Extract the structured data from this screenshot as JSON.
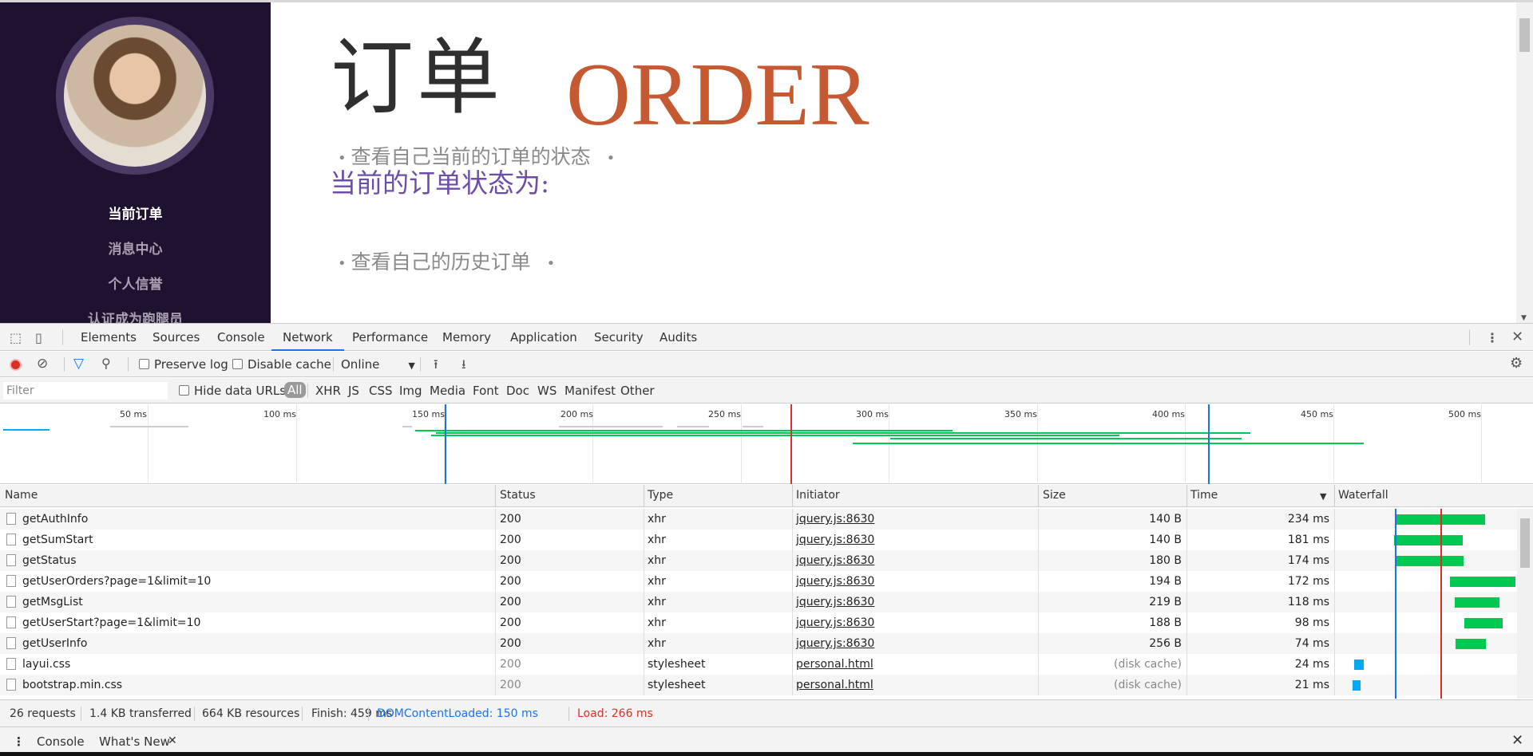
{
  "page": {
    "sidebar": {
      "links": [
        "当前订单",
        "消息中心",
        "个人信誉",
        "认证成为跑腿员"
      ]
    },
    "title_cn": "订单",
    "title_en": "ORDER",
    "bullet1": "查看自己当前的订单的状态",
    "status_title": "当前的订单状态为:",
    "bullet2": "查看自己的历史订单",
    "bullet_dot": "•"
  },
  "devtools": {
    "tabs": [
      "Elements",
      "Sources",
      "Console",
      "Network",
      "Performance",
      "Memory",
      "Application",
      "Security",
      "Audits"
    ],
    "active_tab": "Network",
    "toolbar": {
      "preserve_log": "Preserve log",
      "disable_cache": "Disable cache",
      "throttle": "Online"
    },
    "filter": {
      "placeholder": "Filter",
      "hide_data_urls": "Hide data URLs",
      "types": [
        "All",
        "XHR",
        "JS",
        "CSS",
        "Img",
        "Media",
        "Font",
        "Doc",
        "WS",
        "Manifest",
        "Other"
      ]
    },
    "overview_ticks": [
      "50 ms",
      "100 ms",
      "150 ms",
      "200 ms",
      "250 ms",
      "300 ms",
      "350 ms",
      "400 ms",
      "450 ms",
      "500 ms"
    ],
    "columns": [
      "Name",
      "Status",
      "Type",
      "Initiator",
      "Size",
      "Time",
      "Waterfall"
    ],
    "rows": [
      {
        "name": "getAuthInfo",
        "status": "200",
        "type": "xhr",
        "initiator": "jquery.js:8630",
        "size": "140 B",
        "time": "234 ms"
      },
      {
        "name": "getSumStart",
        "status": "200",
        "type": "xhr",
        "initiator": "jquery.js:8630",
        "size": "140 B",
        "time": "181 ms"
      },
      {
        "name": "getStatus",
        "status": "200",
        "type": "xhr",
        "initiator": "jquery.js:8630",
        "size": "180 B",
        "time": "174 ms"
      },
      {
        "name": "getUserOrders?page=1&limit=10",
        "status": "200",
        "type": "xhr",
        "initiator": "jquery.js:8630",
        "size": "194 B",
        "time": "172 ms"
      },
      {
        "name": "getMsgList",
        "status": "200",
        "type": "xhr",
        "initiator": "jquery.js:8630",
        "size": "219 B",
        "time": "118 ms"
      },
      {
        "name": "getUserStart?page=1&limit=10",
        "status": "200",
        "type": "xhr",
        "initiator": "jquery.js:8630",
        "size": "188 B",
        "time": "98 ms"
      },
      {
        "name": "getUserInfo",
        "status": "200",
        "type": "xhr",
        "initiator": "jquery.js:8630",
        "size": "256 B",
        "time": "74 ms"
      },
      {
        "name": "layui.css",
        "status": "200",
        "type": "stylesheet",
        "initiator": "personal.html",
        "size": "(disk cache)",
        "time": "24 ms"
      },
      {
        "name": "bootstrap.min.css",
        "status": "200",
        "type": "stylesheet",
        "initiator": "personal.html",
        "size": "(disk cache)",
        "time": "21 ms"
      }
    ],
    "summary": {
      "requests": "26 requests",
      "transferred": "1.4 KB transferred",
      "resources": "664 KB resources",
      "finish": "Finish: 459 ms",
      "dcl": "DOMContentLoaded: 150 ms",
      "load": "Load: 266 ms"
    },
    "drawer_tabs": [
      "Console",
      "What's New"
    ],
    "colors": {
      "dcl": "#1a73e8",
      "load": "#d93025",
      "bar": "#00c853",
      "cached": "#03a9f4"
    }
  }
}
